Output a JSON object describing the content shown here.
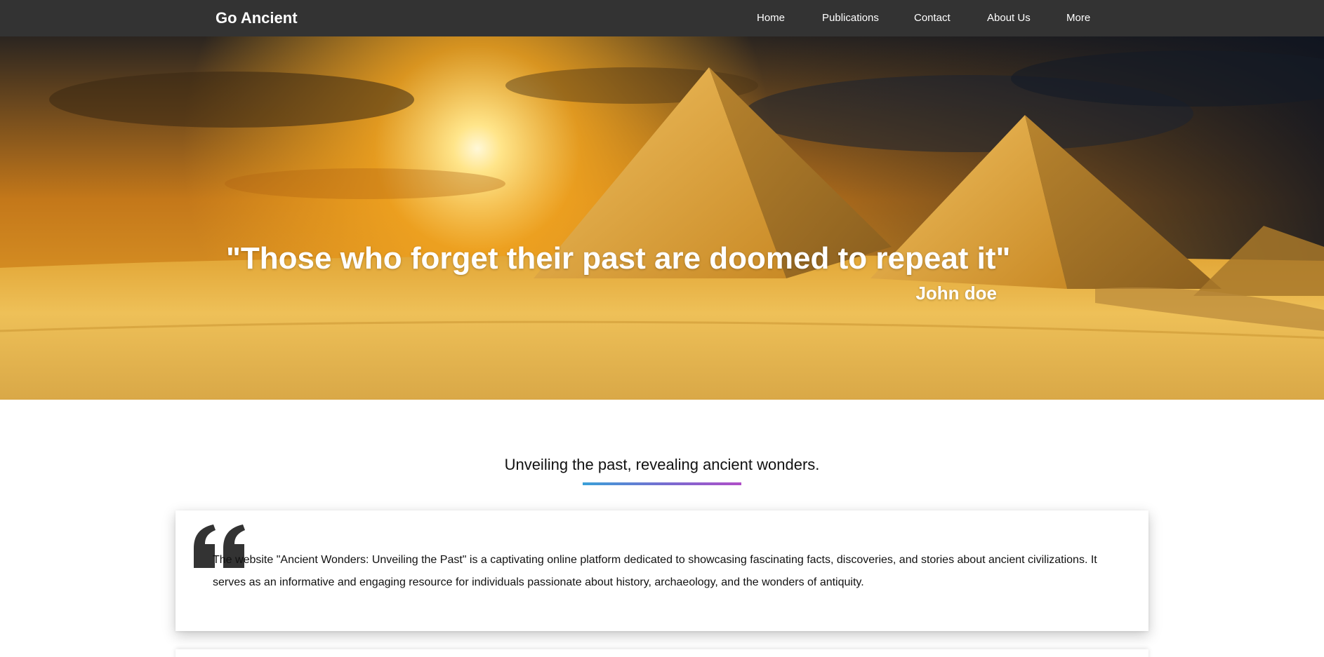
{
  "header": {
    "brand": "Go Ancient",
    "nav": [
      {
        "label": "Home"
      },
      {
        "label": "Publications"
      },
      {
        "label": "Contact"
      },
      {
        "label": "About Us"
      },
      {
        "label": "More"
      }
    ]
  },
  "hero": {
    "quote": "\"Those who forget their past are doomed to repeat it\"",
    "author": "John doe",
    "image_icon": "pyramids-sunset-image"
  },
  "intro": {
    "tagline": "Unveiling the past, revealing ancient wonders.",
    "description": "The website \"Ancient Wonders: Unveiling the Past\" is a captivating online platform dedicated to showcasing fascinating facts, discoveries, and stories about ancient civilizations. It serves as an informative and engaging resource for individuals passionate about history, archaeology, and the wonders of antiquity.",
    "quote_icon": "quote-open-icon"
  },
  "colors": {
    "navbar": "#333333",
    "accent_gradient_start": "#3aa0d8",
    "accent_gradient_end": "#b04ec8",
    "text": "#111111"
  }
}
